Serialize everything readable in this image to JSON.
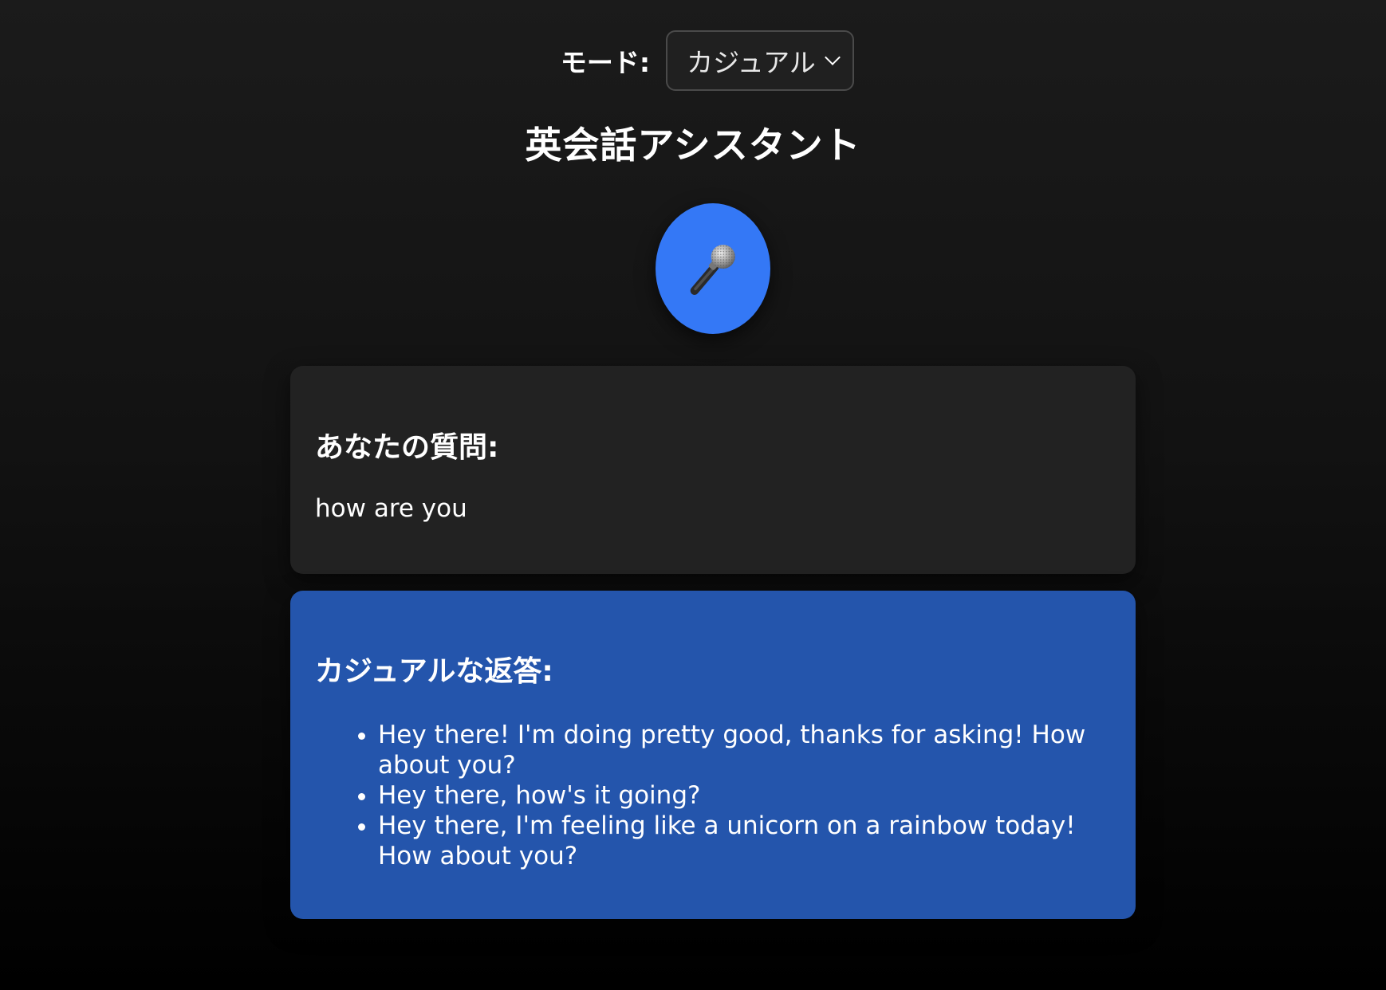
{
  "mode": {
    "label": "モード:",
    "selected": "カジュアル"
  },
  "title": "英会話アシスタント",
  "mic": {
    "icon": "🎤"
  },
  "question": {
    "heading": "あなたの質問:",
    "text": "how are you"
  },
  "answer": {
    "heading": "カジュアルな返答:",
    "items": [
      "Hey there! I'm doing pretty good, thanks for asking! How about you?",
      "Hey there, how's it going?",
      "Hey there, I'm feeling like a unicorn on a rainbow today! How about you?"
    ]
  },
  "colors": {
    "accent": "#3478f6",
    "answer_card": "#2455ac",
    "question_card": "#222222"
  }
}
